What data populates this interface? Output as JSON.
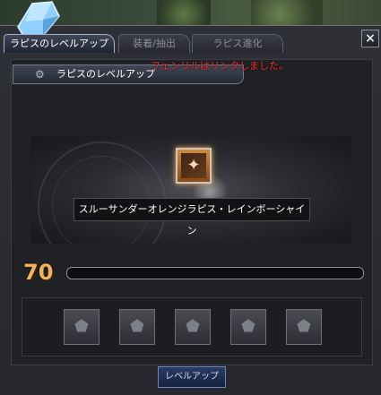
{
  "window": {
    "close_label": "×"
  },
  "tabs": [
    {
      "label": "ラピスのレベルアップ",
      "active": true
    },
    {
      "label": "装着/抽出",
      "active": false
    },
    {
      "label": "ラピス進化",
      "active": false
    }
  ],
  "notice": "フェンリルはリンクしました。",
  "panel": {
    "header_label": "ラピスのレベルアップ"
  },
  "item": {
    "name": "スルーサンダーオレンジラピス・レインボーシャイン"
  },
  "level": {
    "value": "70",
    "exp_fraction": 0
  },
  "slots": {
    "count": 5
  },
  "buttons": {
    "levelup_label": "レベルアップ"
  },
  "colors": {
    "notice": "#ff2a2a",
    "level_number": "#f1b25b",
    "active_tab_border": "#a4adc2"
  },
  "icons": {
    "logo": "blue-crystal-icon",
    "panel_header": "gear-icon",
    "item": "orange-lapis-icon",
    "slot": "lock-icon"
  }
}
